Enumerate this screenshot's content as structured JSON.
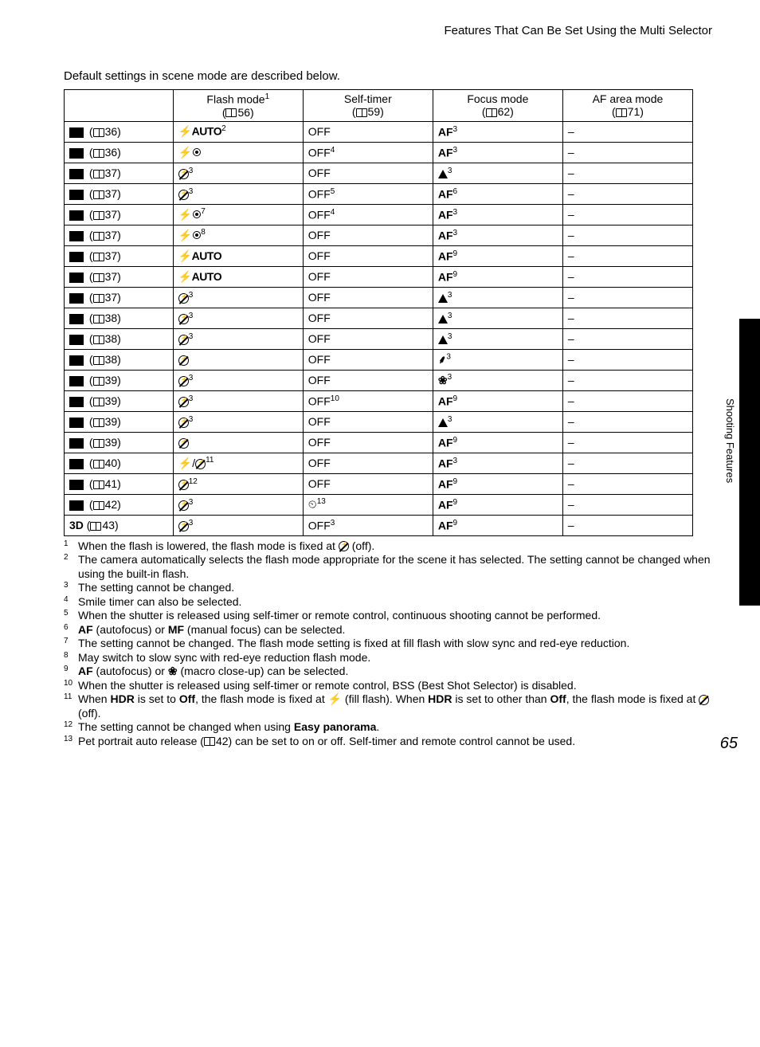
{
  "header": "Features That Can Be Set Using the Multi Selector",
  "intro": "Default settings in scene mode are described below.",
  "side_label": "Shooting Features",
  "page_number": "65",
  "table": {
    "headers": {
      "flash": {
        "label": "Flash mode",
        "sup": "1",
        "page": "56"
      },
      "timer": {
        "label": "Self-timer",
        "page": "59"
      },
      "focus": {
        "label": "Focus mode",
        "page": "62"
      },
      "afarea": {
        "label": "AF area mode",
        "page": "71"
      }
    },
    "rows": [
      {
        "scene_page": "36",
        "scene_icon": "scene-auto",
        "flash": {
          "v": "⚡AUTO",
          "sup": "2"
        },
        "timer": {
          "v": "OFF"
        },
        "focus": {
          "v": "AF",
          "sup": "3"
        },
        "af": "–"
      },
      {
        "scene_page": "36",
        "scene_icon": "portrait",
        "flash": {
          "v": "⚡◉"
        },
        "timer": {
          "v": "OFF",
          "sup": "4"
        },
        "focus": {
          "v": "AF",
          "sup": "3"
        },
        "af": "–"
      },
      {
        "scene_page": "37",
        "scene_icon": "landscape",
        "flash": {
          "v": "⊘",
          "sup": "3"
        },
        "timer": {
          "v": "OFF"
        },
        "focus": {
          "v": "▲",
          "sup": "3"
        },
        "af": "–"
      },
      {
        "scene_page": "37",
        "scene_icon": "sports",
        "flash": {
          "v": "⊘",
          "sup": "3"
        },
        "timer": {
          "v": "OFF",
          "sup": "5"
        },
        "focus": {
          "v": "AF",
          "sup": "6"
        },
        "af": "–"
      },
      {
        "scene_page": "37",
        "scene_icon": "night-portrait",
        "flash": {
          "v": "⚡◉",
          "sup": "7"
        },
        "timer": {
          "v": "OFF",
          "sup": "4"
        },
        "focus": {
          "v": "AF",
          "sup": "3"
        },
        "af": "–"
      },
      {
        "scene_page": "37",
        "scene_icon": "party",
        "flash": {
          "v": "⚡◉",
          "sup": "8"
        },
        "timer": {
          "v": "OFF"
        },
        "focus": {
          "v": "AF",
          "sup": "3"
        },
        "af": "–"
      },
      {
        "scene_page": "37",
        "scene_icon": "beach",
        "flash": {
          "v": "⚡AUTO"
        },
        "timer": {
          "v": "OFF"
        },
        "focus": {
          "v": "AF",
          "sup": "9"
        },
        "af": "–"
      },
      {
        "scene_page": "37",
        "scene_icon": "snow",
        "flash": {
          "v": "⚡AUTO"
        },
        "timer": {
          "v": "OFF"
        },
        "focus": {
          "v": "AF",
          "sup": "9"
        },
        "af": "–"
      },
      {
        "scene_page": "37",
        "scene_icon": "sunset",
        "flash": {
          "v": "⊘",
          "sup": "3"
        },
        "timer": {
          "v": "OFF"
        },
        "focus": {
          "v": "▲",
          "sup": "3"
        },
        "af": "–"
      },
      {
        "scene_page": "38",
        "scene_icon": "dusk",
        "flash": {
          "v": "⊘",
          "sup": "3"
        },
        "timer": {
          "v": "OFF"
        },
        "focus": {
          "v": "▲",
          "sup": "3"
        },
        "af": "–"
      },
      {
        "scene_page": "38",
        "scene_icon": "night-landscape",
        "flash": {
          "v": "⊘",
          "sup": "3"
        },
        "timer": {
          "v": "OFF"
        },
        "focus": {
          "v": "▲",
          "sup": "3"
        },
        "af": "–"
      },
      {
        "scene_page": "38",
        "scene_icon": "closeup",
        "flash": {
          "v": "⊘"
        },
        "timer": {
          "v": "OFF"
        },
        "focus": {
          "v": "⸙",
          "sup": "3"
        },
        "af": "–"
      },
      {
        "scene_page": "39",
        "scene_icon": "food",
        "flash": {
          "v": "⊘",
          "sup": "3"
        },
        "timer": {
          "v": "OFF"
        },
        "focus": {
          "v": "❀",
          "sup": "3"
        },
        "af": "–"
      },
      {
        "scene_page": "39",
        "scene_icon": "museum",
        "flash": {
          "v": "⊘",
          "sup": "3"
        },
        "timer": {
          "v": "OFF",
          "sup": "10"
        },
        "focus": {
          "v": "AF",
          "sup": "9"
        },
        "af": "–"
      },
      {
        "scene_page": "39",
        "scene_icon": "fireworks",
        "flash": {
          "v": "⊘",
          "sup": "3"
        },
        "timer": {
          "v": "OFF"
        },
        "focus": {
          "v": "▲",
          "sup": "3"
        },
        "af": "–"
      },
      {
        "scene_page": "39",
        "scene_icon": "copy",
        "flash": {
          "v": "⊘"
        },
        "timer": {
          "v": "OFF"
        },
        "focus": {
          "v": "AF",
          "sup": "9"
        },
        "af": "–"
      },
      {
        "scene_page": "40",
        "scene_icon": "backlight",
        "flash": {
          "v": "⚡/⊘",
          "sup": "11"
        },
        "timer": {
          "v": "OFF"
        },
        "focus": {
          "v": "AF",
          "sup": "3"
        },
        "af": "–"
      },
      {
        "scene_page": "41",
        "scene_icon": "panorama",
        "flash": {
          "v": "⊘",
          "sup": "12"
        },
        "timer": {
          "v": "OFF"
        },
        "focus": {
          "v": "AF",
          "sup": "9"
        },
        "af": "–"
      },
      {
        "scene_page": "42",
        "scene_icon": "pet",
        "flash": {
          "v": "⊘",
          "sup": "3"
        },
        "timer": {
          "v": "⏲",
          "sup": "13"
        },
        "focus": {
          "v": "AF",
          "sup": "9"
        },
        "af": "–"
      },
      {
        "scene_page": "43",
        "scene_icon": "3d",
        "scene_text": "3D",
        "flash": {
          "v": "⊘",
          "sup": "3"
        },
        "timer": {
          "v": "OFF",
          "sup": "3"
        },
        "focus": {
          "v": "AF",
          "sup": "9"
        },
        "af": "–"
      }
    ]
  },
  "footnotes": [
    {
      "n": "1",
      "t": "When the flash is lowered, the flash mode is fixed at ⊘ (off)."
    },
    {
      "n": "2",
      "t": "The camera automatically selects the flash mode appropriate for the scene it has selected. The setting cannot be changed when using the built-in flash."
    },
    {
      "n": "3",
      "t": "The setting cannot be changed."
    },
    {
      "n": "4",
      "t": "Smile timer can also be selected."
    },
    {
      "n": "5",
      "t": "When the shutter is released using self-timer or remote control, continuous shooting cannot be performed."
    },
    {
      "n": "6",
      "t": "AF (autofocus) or MF (manual focus) can be selected.",
      "bold": [
        "AF",
        "MF"
      ]
    },
    {
      "n": "7",
      "t": "The setting cannot be changed. The flash mode setting is fixed at fill flash with slow sync and red-eye reduction."
    },
    {
      "n": "8",
      "t": "May switch to slow sync with red-eye reduction flash mode."
    },
    {
      "n": "9",
      "t": "AF (autofocus) or ❀ (macro close-up) can be selected.",
      "bold": [
        "AF"
      ]
    },
    {
      "n": "10",
      "t": "When the shutter is released using self-timer or remote control, BSS (Best Shot Selector) is disabled."
    },
    {
      "n": "11",
      "t": "When HDR is set to Off, the flash mode is fixed at ⚡ (fill flash). When HDR is set to other than Off, the flash mode is fixed at ⊘ (off).",
      "bold": [
        "HDR",
        "Off"
      ]
    },
    {
      "n": "12",
      "t": "The setting cannot be changed when using Easy panorama.",
      "bold": [
        "Easy panorama"
      ]
    },
    {
      "n": "13",
      "t": "Pet portrait auto release (📖42) can be set to on or off. Self-timer and remote control cannot be used."
    }
  ]
}
